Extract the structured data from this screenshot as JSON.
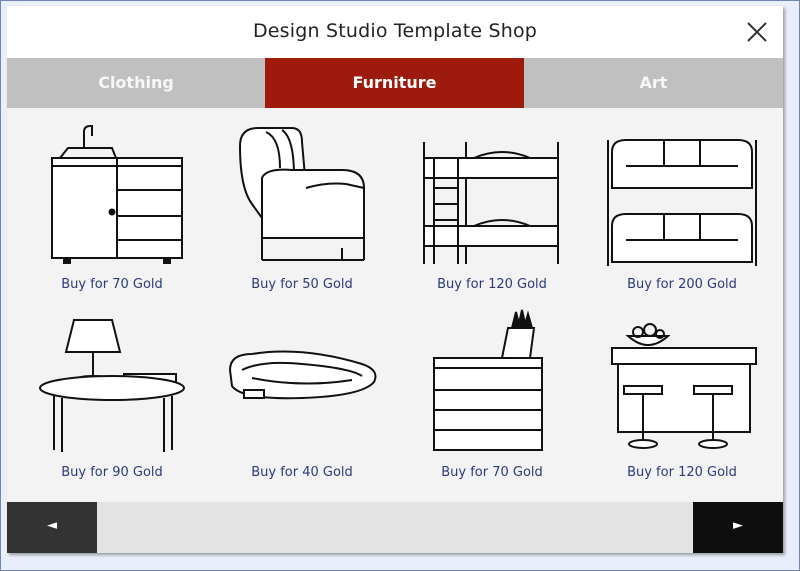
{
  "window": {
    "title": "Design Studio Template Shop"
  },
  "tabs": [
    {
      "label": "Clothing",
      "active": false
    },
    {
      "label": "Furniture",
      "active": true
    },
    {
      "label": "Art",
      "active": false
    }
  ],
  "items": [
    {
      "icon": "kitchen-sink-cabinet-icon",
      "price": "Buy for 70 Gold"
    },
    {
      "icon": "armchair-icon",
      "price": "Buy for 50 Gold"
    },
    {
      "icon": "bunk-bed-icon",
      "price": "Buy for 120 Gold"
    },
    {
      "icon": "sofa-bunk-icon",
      "price": "Buy for 200 Gold"
    },
    {
      "icon": "side-table-lamp-icon",
      "price": "Buy for 90 Gold"
    },
    {
      "icon": "pet-bed-icon",
      "price": "Buy for 40 Gold"
    },
    {
      "icon": "kitchen-drawers-knife-block-icon",
      "price": "Buy for 70 Gold"
    },
    {
      "icon": "kitchen-island-stools-icon",
      "price": "Buy for 120 Gold"
    }
  ],
  "nav": {
    "prev_glyph": "◄",
    "next_glyph": "►"
  },
  "colors": {
    "active_tab": "#9d1a0d",
    "tab_bar": "#c0c0c0",
    "price_text": "#2c3a78"
  }
}
